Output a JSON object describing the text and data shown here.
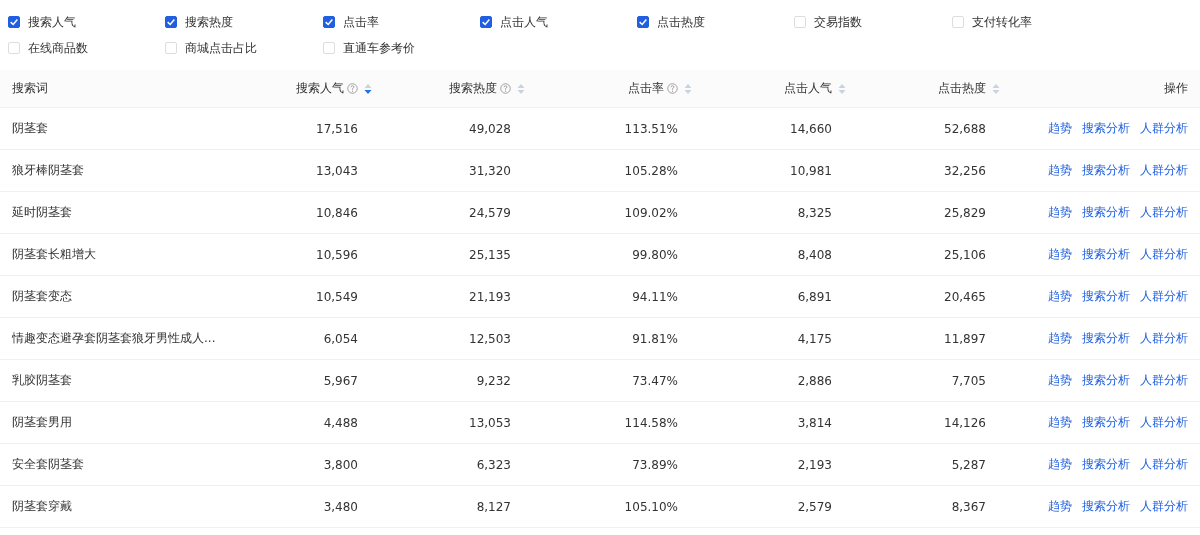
{
  "metric_options": [
    {
      "label": "搜索人气",
      "checked": true
    },
    {
      "label": "搜索热度",
      "checked": true
    },
    {
      "label": "点击率",
      "checked": true
    },
    {
      "label": "点击人气",
      "checked": true
    },
    {
      "label": "点击热度",
      "checked": true
    },
    {
      "label": "交易指数",
      "checked": false
    },
    {
      "label": "支付转化率",
      "checked": false
    },
    {
      "label": "在线商品数",
      "checked": false
    },
    {
      "label": "商城点击占比",
      "checked": false
    },
    {
      "label": "直通车参考价",
      "checked": false
    }
  ],
  "table": {
    "columns": [
      {
        "label": "搜索词",
        "kind": "text"
      },
      {
        "label": "搜索人气",
        "kind": "metric",
        "help": true,
        "sorted_desc": true
      },
      {
        "label": "搜索热度",
        "kind": "metric",
        "help": true,
        "sorted_desc": false
      },
      {
        "label": "点击率",
        "kind": "metric",
        "help": true,
        "sorted_desc": false
      },
      {
        "label": "点击人气",
        "kind": "metric",
        "help": false,
        "sorted_desc": false
      },
      {
        "label": "点击热度",
        "kind": "metric",
        "help": false,
        "sorted_desc": false
      },
      {
        "label": "操作",
        "kind": "action"
      }
    ],
    "rows": [
      {
        "cells": [
          "阴茎套",
          "17,516",
          "49,028",
          "113.51%",
          "14,660",
          "52,688"
        ],
        "actions": [
          "趋势",
          "搜索分析",
          "人群分析"
        ]
      },
      {
        "cells": [
          "狼牙棒阴茎套",
          "13,043",
          "31,320",
          "105.28%",
          "10,981",
          "32,256"
        ],
        "actions": [
          "趋势",
          "搜索分析",
          "人群分析"
        ]
      },
      {
        "cells": [
          "延时阴茎套",
          "10,846",
          "24,579",
          "109.02%",
          "8,325",
          "25,829"
        ],
        "actions": [
          "趋势",
          "搜索分析",
          "人群分析"
        ]
      },
      {
        "cells": [
          "阴茎套长粗增大",
          "10,596",
          "25,135",
          "99.80%",
          "8,408",
          "25,106"
        ],
        "actions": [
          "趋势",
          "搜索分析",
          "人群分析"
        ]
      },
      {
        "cells": [
          "阴茎套变态",
          "10,549",
          "21,193",
          "94.11%",
          "6,891",
          "20,465"
        ],
        "actions": [
          "趋势",
          "搜索分析",
          "人群分析"
        ]
      },
      {
        "cells": [
          "情趣变态避孕套阴茎套狼牙男性成人...",
          "6,054",
          "12,503",
          "91.81%",
          "4,175",
          "11,897"
        ],
        "actions": [
          "趋势",
          "搜索分析",
          "人群分析"
        ]
      },
      {
        "cells": [
          "乳胶阴茎套",
          "5,967",
          "9,232",
          "73.47%",
          "2,886",
          "7,705"
        ],
        "actions": [
          "趋势",
          "搜索分析",
          "人群分析"
        ]
      },
      {
        "cells": [
          "阴茎套男用",
          "4,488",
          "13,053",
          "114.58%",
          "3,814",
          "14,126"
        ],
        "actions": [
          "趋势",
          "搜索分析",
          "人群分析"
        ]
      },
      {
        "cells": [
          "安全套阴茎套",
          "3,800",
          "6,323",
          "73.89%",
          "2,193",
          "5,287"
        ],
        "actions": [
          "趋势",
          "搜索分析",
          "人群分析"
        ]
      },
      {
        "cells": [
          "阴茎套穿戴",
          "3,480",
          "8,127",
          "105.10%",
          "2,579",
          "8,367"
        ],
        "actions": [
          "趋势",
          "搜索分析",
          "人群分析"
        ]
      }
    ]
  }
}
